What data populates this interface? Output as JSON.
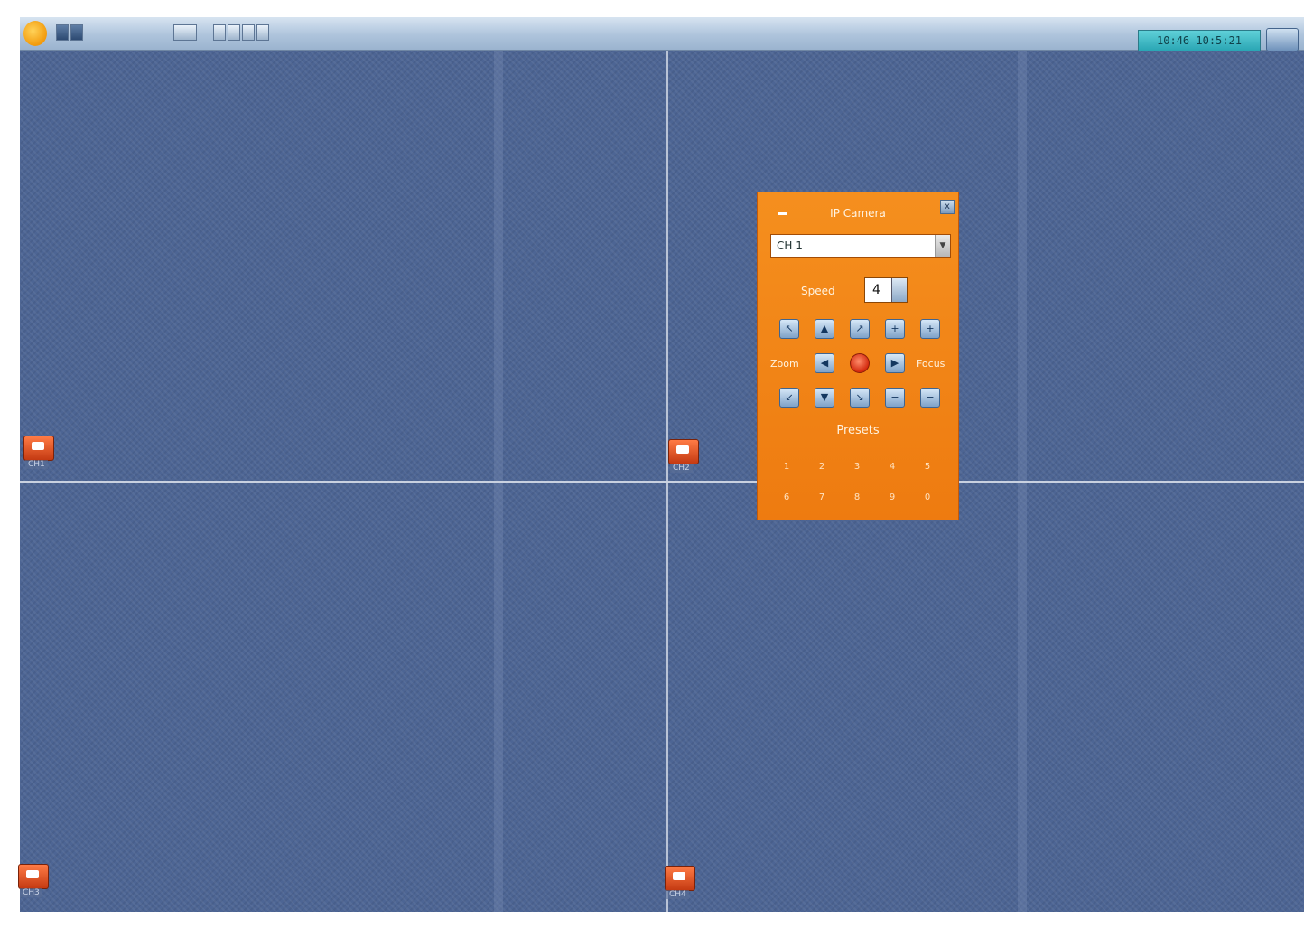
{
  "toolbar": {
    "clock": "10:46  10:5:21"
  },
  "cameras": [
    {
      "id": "cam1",
      "label": "CH1"
    },
    {
      "id": "cam2",
      "label": "CH2"
    },
    {
      "id": "cam3",
      "label": "CH3"
    },
    {
      "id": "cam4",
      "label": "CH4"
    }
  ],
  "ptz_panel": {
    "title": "IP Camera",
    "camera_select_value": "CH 1",
    "speed_label": "Speed",
    "speed_value": "4",
    "close_label": "x",
    "zoom_left_label": "Zoom",
    "zoom_right_label": "Focus",
    "presets_label": "Presets",
    "presets": [
      "1",
      "2",
      "3",
      "4",
      "5",
      "6",
      "7",
      "8",
      "9",
      "0"
    ]
  },
  "colors": {
    "grid_bg": "#4d6594",
    "panel_bg": "#f08416",
    "toolbar_bg": "#aec4dc"
  }
}
